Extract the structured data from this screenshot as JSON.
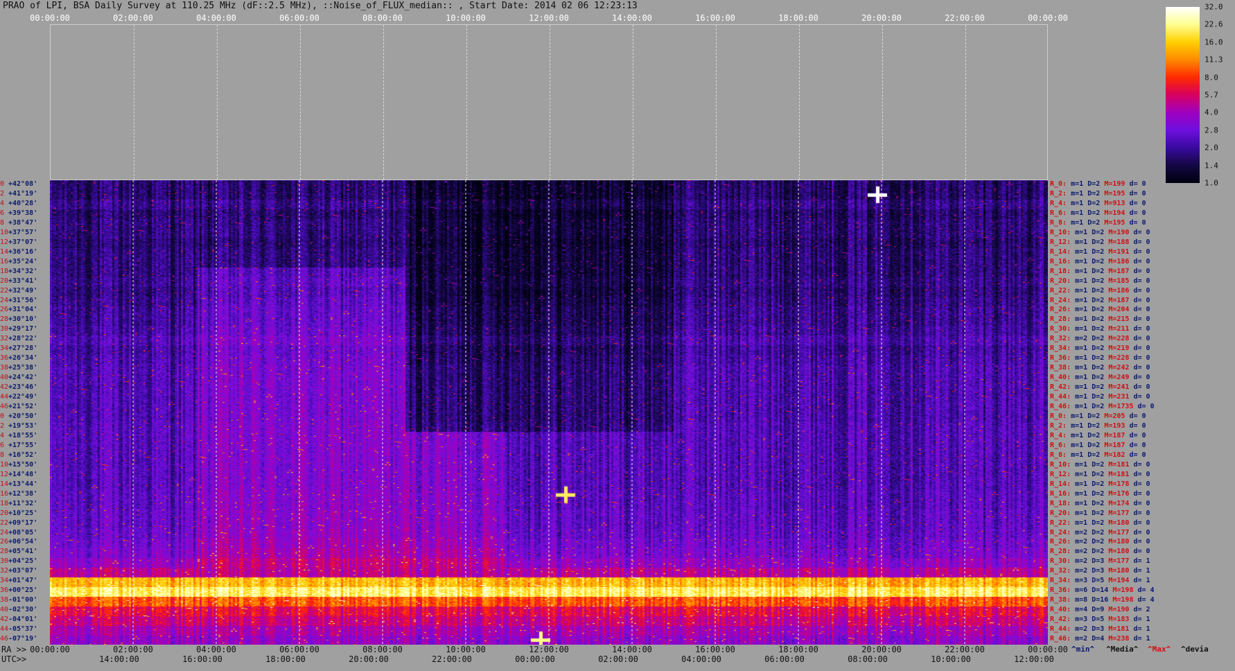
{
  "title": "PRAO of LPI, BSA Daily Survey at 110.25 MHz (dF::2.5 MHz), ::Noise_of_FLUX_median:: , Start Date: 2014 02 06 12:23:13",
  "top_axis_ticks": [
    "00:00:00",
    "02:00:00",
    "04:00:00",
    "06:00:00",
    "08:00:00",
    "10:00:00",
    "12:00:00",
    "14:00:00",
    "16:00:00",
    "18:00:00",
    "20:00:00",
    "22:00:00",
    "00:00:00"
  ],
  "ra_label": "RA >>",
  "ra_ticks": [
    "00:00:00",
    "02:00:00",
    "04:00:00",
    "06:00:00",
    "08:00:00",
    "10:00:00",
    "12:00:00",
    "14:00:00",
    "16:00:00",
    "18:00:00",
    "20:00:00",
    "22:00:00",
    "00:00:00"
  ],
  "utc_label": "UTC>>",
  "utc_ticks": [
    "14:00:00",
    "16:00:00",
    "18:00:00",
    "20:00:00",
    "22:00:00",
    "00:00:00",
    "02:00:00",
    "04:00:00",
    "06:00:00",
    "08:00:00",
    "10:00:00",
    "12:00:00"
  ],
  "colorbar_ticks": [
    "32.0",
    "22.6",
    "16.0",
    "11.3",
    "8.0",
    "5.7",
    "4.0",
    "2.8",
    "2.0",
    "1.4",
    "1.0"
  ],
  "colorbar_colors": [
    "#ffffff",
    "#ffff90",
    "#ffd000",
    "#ff8a00",
    "#ff2a00",
    "#d80060",
    "#a000c0",
    "#7010e0",
    "#3a0aa0",
    "#150845",
    "#000010"
  ],
  "legend": {
    "min": "^min^",
    "median": "^Media^",
    "max": "^Max^",
    "devia": "^devia"
  },
  "rows": [
    {
      "idx": "0",
      "dec": "+42°08'",
      "r": "R_0:",
      "m": "m=1",
      "D": "D=2",
      "M": "M=199",
      "d": "d= 0"
    },
    {
      "idx": "2",
      "dec": "+41°19'",
      "r": "R_2:",
      "m": "m=1",
      "D": "D=2",
      "M": "M=195",
      "d": "d= 0"
    },
    {
      "idx": "4",
      "dec": "+40°28'",
      "r": "R_4:",
      "m": "m=1",
      "D": "D=2",
      "M": "M=913",
      "d": "d= 0"
    },
    {
      "idx": "6",
      "dec": "+39°38'",
      "r": "R_6:",
      "m": "m=1",
      "D": "D=2",
      "M": "M=194",
      "d": "d= 0"
    },
    {
      "idx": "8",
      "dec": "+38°47'",
      "r": "R_8:",
      "m": "m=1",
      "D": "D=2",
      "M": "M=195",
      "d": "d= 0"
    },
    {
      "idx": "10",
      "dec": "+37°57'",
      "r": "R_10:",
      "m": "m=1",
      "D": "D=2",
      "M": "M=190",
      "d": "d= 0"
    },
    {
      "idx": "12",
      "dec": "+37°07'",
      "r": "R_12:",
      "m": "m=1",
      "D": "D=2",
      "M": "M=188",
      "d": "d= 0"
    },
    {
      "idx": "14",
      "dec": "+36°16'",
      "r": "R_14:",
      "m": "m=1",
      "D": "D=2",
      "M": "M=191",
      "d": "d= 0"
    },
    {
      "idx": "16",
      "dec": "+35°24'",
      "r": "R_16:",
      "m": "m=1",
      "D": "D=2",
      "M": "M=186",
      "d": "d= 0"
    },
    {
      "idx": "18",
      "dec": "+34°32'",
      "r": "R_18:",
      "m": "m=1",
      "D": "D=2",
      "M": "M=187",
      "d": "d= 0"
    },
    {
      "idx": "20",
      "dec": "+33°41'",
      "r": "R_20:",
      "m": "m=1",
      "D": "D=2",
      "M": "M=185",
      "d": "d= 0"
    },
    {
      "idx": "22",
      "dec": "+32°49'",
      "r": "R_22:",
      "m": "m=1",
      "D": "D=2",
      "M": "M=186",
      "d": "d= 0"
    },
    {
      "idx": "24",
      "dec": "+31°56'",
      "r": "R_24:",
      "m": "m=1",
      "D": "D=2",
      "M": "M=187",
      "d": "d= 0"
    },
    {
      "idx": "26",
      "dec": "+31°04'",
      "r": "R_26:",
      "m": "m=1",
      "D": "D=2",
      "M": "M=204",
      "d": "d= 0"
    },
    {
      "idx": "28",
      "dec": "+30°10'",
      "r": "R_28:",
      "m": "m=1",
      "D": "D=2",
      "M": "M=215",
      "d": "d= 0"
    },
    {
      "idx": "30",
      "dec": "+29°17'",
      "r": "R_30:",
      "m": "m=1",
      "D": "D=2",
      "M": "M=211",
      "d": "d= 0"
    },
    {
      "idx": "32",
      "dec": "+28°22'",
      "r": "R_32:",
      "m": "m=2",
      "D": "D=2",
      "M": "M=228",
      "d": "d= 0"
    },
    {
      "idx": "34",
      "dec": "+27°28'",
      "r": "R_34:",
      "m": "m=1",
      "D": "D=2",
      "M": "M=219",
      "d": "d= 0"
    },
    {
      "idx": "36",
      "dec": "+26°34'",
      "r": "R_36:",
      "m": "m=1",
      "D": "D=2",
      "M": "M=228",
      "d": "d= 0"
    },
    {
      "idx": "38",
      "dec": "+25°38'",
      "r": "R_38:",
      "m": "m=1",
      "D": "D=2",
      "M": "M=242",
      "d": "d= 0"
    },
    {
      "idx": "40",
      "dec": "+24°42'",
      "r": "R_40:",
      "m": "m=1",
      "D": "D=2",
      "M": "M=249",
      "d": "d= 0"
    },
    {
      "idx": "42",
      "dec": "+23°46'",
      "r": "R_42:",
      "m": "m=1",
      "D": "D=2",
      "M": "M=241",
      "d": "d= 0"
    },
    {
      "idx": "44",
      "dec": "+22°49'",
      "r": "R_44:",
      "m": "m=1",
      "D": "D=2",
      "M": "M=231",
      "d": "d= 0"
    },
    {
      "idx": "46",
      "dec": "+21°52'",
      "r": "R_46:",
      "m": "m=1",
      "D": "D=2",
      "M": "M=1735",
      "d": "d= 0"
    },
    {
      "idx": "0",
      "dec": "+20°50'",
      "r": "R_0:",
      "m": "m=1",
      "D": "D=2",
      "M": "M=205",
      "d": "d= 0"
    },
    {
      "idx": "2",
      "dec": "+19°53'",
      "r": "R_2:",
      "m": "m=1",
      "D": "D=2",
      "M": "M=193",
      "d": "d= 0"
    },
    {
      "idx": "4",
      "dec": "+18°55'",
      "r": "R_4:",
      "m": "m=1",
      "D": "D=2",
      "M": "M=187",
      "d": "d= 0"
    },
    {
      "idx": "6",
      "dec": "+17°55'",
      "r": "R_6:",
      "m": "m=1",
      "D": "D=2",
      "M": "M=187",
      "d": "d= 0"
    },
    {
      "idx": "8",
      "dec": "+16°52'",
      "r": "R_8:",
      "m": "m=1",
      "D": "D=2",
      "M": "M=182",
      "d": "d= 0"
    },
    {
      "idx": "10",
      "dec": "+15°50'",
      "r": "R_10:",
      "m": "m=1",
      "D": "D=2",
      "M": "M=181",
      "d": "d= 0"
    },
    {
      "idx": "12",
      "dec": "+14°48'",
      "r": "R_12:",
      "m": "m=1",
      "D": "D=2",
      "M": "M=181",
      "d": "d= 0"
    },
    {
      "idx": "14",
      "dec": "+13°44'",
      "r": "R_14:",
      "m": "m=1",
      "D": "D=2",
      "M": "M=178",
      "d": "d= 0"
    },
    {
      "idx": "16",
      "dec": "+12°38'",
      "r": "R_16:",
      "m": "m=1",
      "D": "D=2",
      "M": "M=176",
      "d": "d= 0"
    },
    {
      "idx": "18",
      "dec": "+11°32'",
      "r": "R_18:",
      "m": "m=1",
      "D": "D=2",
      "M": "M=174",
      "d": "d= 0"
    },
    {
      "idx": "20",
      "dec": "+10°25'",
      "r": "R_20:",
      "m": "m=1",
      "D": "D=2",
      "M": "M=177",
      "d": "d= 0"
    },
    {
      "idx": "22",
      "dec": "+09°17'",
      "r": "R_22:",
      "m": "m=1",
      "D": "D=2",
      "M": "M=180",
      "d": "d= 0"
    },
    {
      "idx": "24",
      "dec": "+08°05'",
      "r": "R_24:",
      "m": "m=2",
      "D": "D=2",
      "M": "M=177",
      "d": "d= 0"
    },
    {
      "idx": "26",
      "dec": "+06°54'",
      "r": "R_26:",
      "m": "m=2",
      "D": "D=2",
      "M": "M=180",
      "d": "d= 0"
    },
    {
      "idx": "28",
      "dec": "+05°41'",
      "r": "R_28:",
      "m": "m=2",
      "D": "D=2",
      "M": "M=180",
      "d": "d= 0"
    },
    {
      "idx": "30",
      "dec": "+04°25'",
      "r": "R_30:",
      "m": "m=2",
      "D": "D=3",
      "M": "M=177",
      "d": "d= 1"
    },
    {
      "idx": "32",
      "dec": "+03°07'",
      "r": "R_32:",
      "m": "m=2",
      "D": "D=3",
      "M": "M=180",
      "d": "d= 1"
    },
    {
      "idx": "34",
      "dec": "+01°47'",
      "r": "R_34:",
      "m": "m=3",
      "D": "D=5",
      "M": "M=194",
      "d": "d= 1"
    },
    {
      "idx": "36",
      "dec": "+00°25'",
      "r": "R_36:",
      "m": "m=6",
      "D": "D=14",
      "M": "M=198",
      "d": "d= 4"
    },
    {
      "idx": "38",
      "dec": "-01°00'",
      "r": "R_38:",
      "m": "m=8",
      "D": "D=16",
      "M": "M=198",
      "d": "d= 4"
    },
    {
      "idx": "40",
      "dec": "-02°30'",
      "r": "R_40:",
      "m": "m=4",
      "D": "D=9",
      "M": "M=190",
      "d": "d= 2"
    },
    {
      "idx": "42",
      "dec": "-04°01'",
      "r": "R_42:",
      "m": "m=3",
      "D": "D=5",
      "M": "M=183",
      "d": "d= 1"
    },
    {
      "idx": "44",
      "dec": "-05°37'",
      "r": "R_44:",
      "m": "m=2",
      "D": "D=3",
      "M": "M=181",
      "d": "d= 1"
    },
    {
      "idx": "46",
      "dec": "-07°19'",
      "r": "R_46:",
      "m": "m=2",
      "D": "D=4",
      "M": "M=238",
      "d": "d= 1"
    }
  ],
  "chart_data": {
    "type": "heatmap",
    "title": "PRAO of LPI, BSA Daily Survey at 110.25 MHz (dF::2.5 MHz), ::Noise_of_FLUX_median:: , Start Date: 2014 02 06 12:23:13",
    "x_axis_top": "sidereal time 00:00:00 to 00:00:00",
    "x_axis_bottom": "RA 00:00:00 to 00:00:00 / UTC 14:00:00 to 12:00:00",
    "y_axis": "declination +42°08' to -07°19' (48 beams)",
    "colorbar_range": [
      1.0,
      32.0
    ],
    "colorbar_scale": "log",
    "row_intensity_levels": [
      1.6,
      1.6,
      1.8,
      1.6,
      1.7,
      1.7,
      1.6,
      1.7,
      1.7,
      1.7,
      1.8,
      1.7,
      1.8,
      1.9,
      1.9,
      2.0,
      2.2,
      2.0,
      2.1,
      2.2,
      2.2,
      2.2,
      2.2,
      2.2,
      2.2,
      2.3,
      2.3,
      2.3,
      2.3,
      2.3,
      2.3,
      2.3,
      2.4,
      2.4,
      2.5,
      2.5,
      2.6,
      2.8,
      3.0,
      3.5,
      4.5,
      14,
      20,
      9,
      6,
      5,
      4,
      3.5
    ],
    "hot_sources": [
      {
        "ra_h": 19.9,
        "dec_row": 1,
        "level": 32
      },
      {
        "ra_h": 12.4,
        "dec_row": 32,
        "level": 20
      },
      {
        "ra_h": 11.8,
        "dec_row": 47,
        "level": 22
      }
    ]
  }
}
